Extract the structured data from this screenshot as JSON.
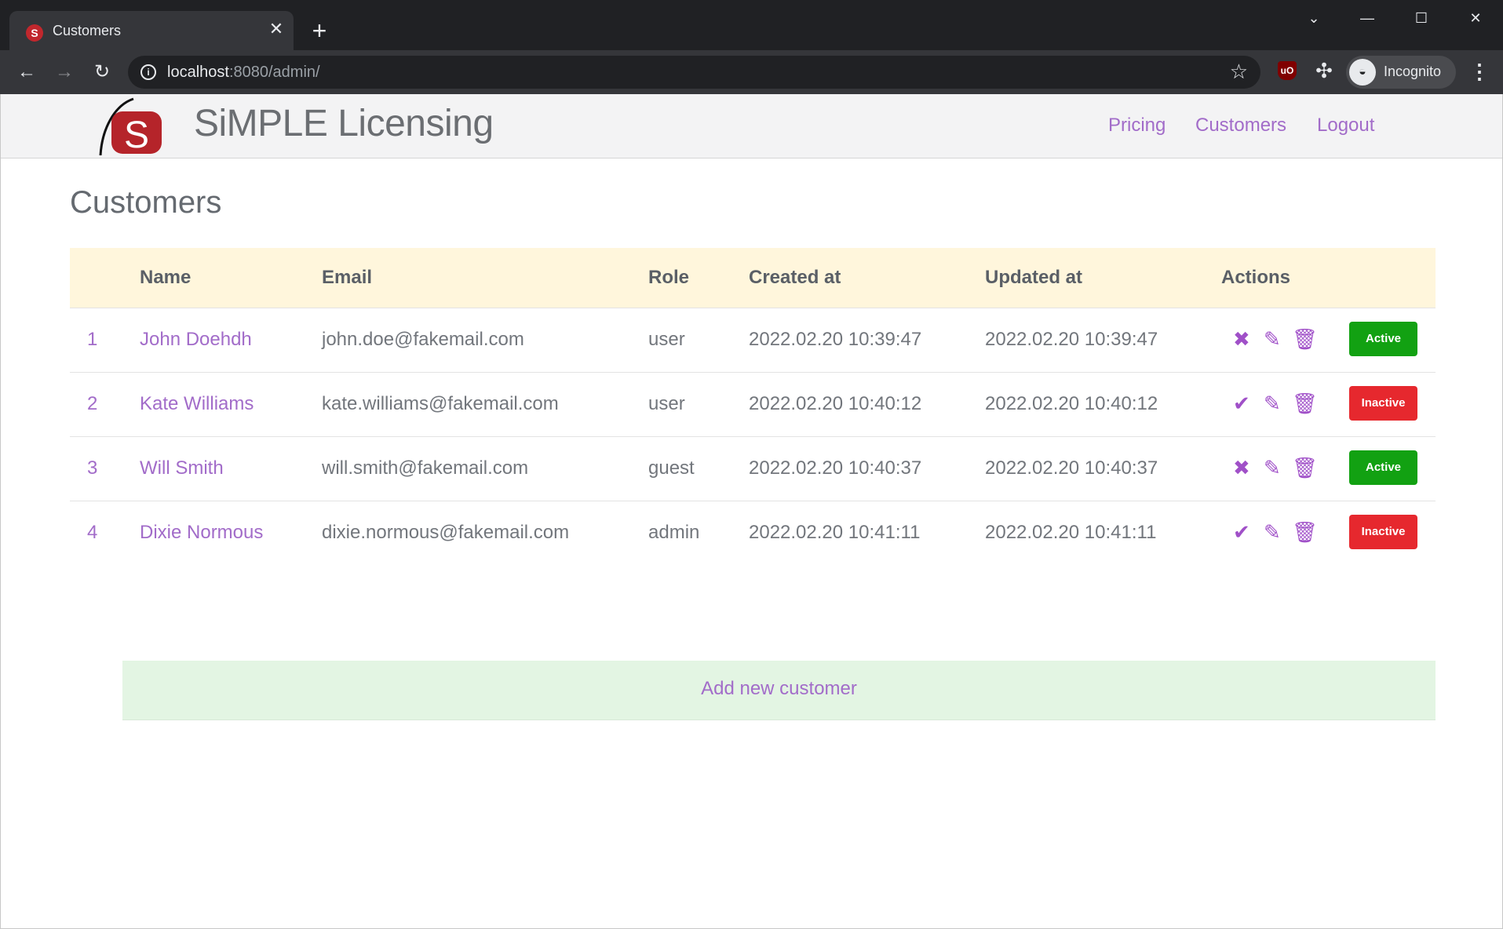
{
  "browser": {
    "tab_title": "Customers",
    "tab_favicon": "S",
    "url_host": "localhost",
    "url_rest": ":8080/admin/",
    "profile_label": "Incognito",
    "extension_ublock": "uO"
  },
  "site": {
    "brand": "SiMPLE Licensing",
    "logo_letter": "S",
    "nav": [
      "Pricing",
      "Customers",
      "Logout"
    ]
  },
  "page": {
    "title": "Customers"
  },
  "table": {
    "columns": [
      "",
      "Name",
      "Email",
      "Role",
      "Created at",
      "Updated at",
      "Actions"
    ],
    "rows": [
      {
        "id": "1",
        "name": "John Doehdh",
        "email": "john.doe@fakemail.com",
        "role": "user",
        "created": "2022.02.20 10:39:47",
        "updated": "2022.02.20 10:39:47",
        "toggle_icon": "x-icon",
        "status": "Active"
      },
      {
        "id": "2",
        "name": "Kate Williams",
        "email": "kate.williams@fakemail.com",
        "role": "user",
        "created": "2022.02.20 10:40:12",
        "updated": "2022.02.20 10:40:12",
        "toggle_icon": "check-icon",
        "status": "Inactive"
      },
      {
        "id": "3",
        "name": "Will Smith",
        "email": "will.smith@fakemail.com",
        "role": "guest",
        "created": "2022.02.20 10:40:37",
        "updated": "2022.02.20 10:40:37",
        "toggle_icon": "x-icon",
        "status": "Active"
      },
      {
        "id": "4",
        "name": "Dixie Normous",
        "email": "dixie.normous@fakemail.com",
        "role": "admin",
        "created": "2022.02.20 10:41:11",
        "updated": "2022.02.20 10:41:11",
        "toggle_icon": "check-icon",
        "status": "Inactive"
      }
    ],
    "add_label": "Add new customer"
  },
  "colors": {
    "accent": "#a26cc9",
    "active": "#12a112",
    "inactive": "#e6282e",
    "header_bg": "#fff6dc",
    "add_bg": "#e3f5e3"
  }
}
